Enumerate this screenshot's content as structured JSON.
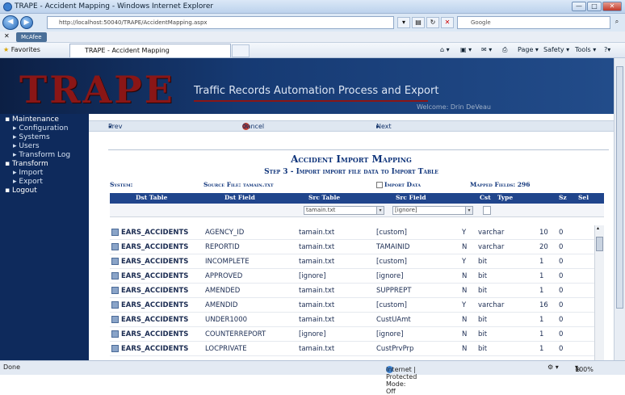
{
  "window": {
    "title": "TRAPE - Accident Mapping - Windows Internet Explorer",
    "address": "http://localhost:50040/TRAPE/AccidentMapping.aspx",
    "address_host": "localhost",
    "search_engine": "Google",
    "tab_title": "TRAPE - Accident Mapping",
    "favorites_label": "Favorites",
    "mcafee_label": "McAfee",
    "commands": [
      "Page",
      "Safety",
      "Tools"
    ]
  },
  "banner": {
    "logo": "TRAPE",
    "tagline": "Traffic Records Automation Process and Export",
    "welcome": "Welcome: Drin DeVeau"
  },
  "sidebar": {
    "items": [
      {
        "label": "Maintenance",
        "level": 0
      },
      {
        "label": "Configuration",
        "level": 1
      },
      {
        "label": "Systems",
        "level": 1
      },
      {
        "label": "Users",
        "level": 1
      },
      {
        "label": "Transform Log",
        "level": 1
      },
      {
        "label": "Transform",
        "level": 0
      },
      {
        "label": "Import",
        "level": 1
      },
      {
        "label": "Export",
        "level": 1
      },
      {
        "label": "Logout",
        "level": 0
      }
    ]
  },
  "actions": {
    "prev": "Prev",
    "cancel": "Cancel",
    "next": "Next"
  },
  "page": {
    "heading": "Accident Import Mapping",
    "step": "Step 3 - Import import file data to Import Table",
    "system_label": "System:",
    "source_file_label": "Source File: tamain.txt",
    "import_data_label": "Import Data",
    "mapped_fields_label": "Mapped Fields: 296"
  },
  "table": {
    "headers": [
      "Dst Table",
      "Dst Field",
      "Src Table",
      "Src Field",
      "Cst",
      "Type",
      "Sz",
      "Sel"
    ],
    "filters": {
      "src_table": "tamain.txt",
      "src_field": "[ignore]"
    },
    "rows": [
      [
        "EARS_ACCIDENTS",
        "AGENCY_ID",
        "tamain.txt",
        "[custom]",
        "Y",
        "varchar",
        "10",
        "0"
      ],
      [
        "EARS_ACCIDENTS",
        "REPORTID",
        "tamain.txt",
        "TAMAINID",
        "N",
        "varchar",
        "20",
        "0"
      ],
      [
        "EARS_ACCIDENTS",
        "INCOMPLETE",
        "tamain.txt",
        "[custom]",
        "Y",
        "bit",
        "1",
        "0"
      ],
      [
        "EARS_ACCIDENTS",
        "APPROVED",
        "[ignore]",
        "[ignore]",
        "N",
        "bit",
        "1",
        "0"
      ],
      [
        "EARS_ACCIDENTS",
        "AMENDED",
        "tamain.txt",
        "SUPPREPT",
        "N",
        "bit",
        "1",
        "0"
      ],
      [
        "EARS_ACCIDENTS",
        "AMENDID",
        "tamain.txt",
        "[custom]",
        "Y",
        "varchar",
        "16",
        "0"
      ],
      [
        "EARS_ACCIDENTS",
        "UNDER1000",
        "tamain.txt",
        "CustUAmt",
        "N",
        "bit",
        "1",
        "0"
      ],
      [
        "EARS_ACCIDENTS",
        "COUNTERREPORT",
        "[ignore]",
        "[ignore]",
        "N",
        "bit",
        "1",
        "0"
      ],
      [
        "EARS_ACCIDENTS",
        "LOCPRIVATE",
        "tamain.txt",
        "CustPrvPrp",
        "N",
        "bit",
        "1",
        "0"
      ]
    ]
  },
  "status": {
    "left": "Done",
    "zone": "Internet | Protected Mode: Off",
    "zoom": "100%"
  }
}
